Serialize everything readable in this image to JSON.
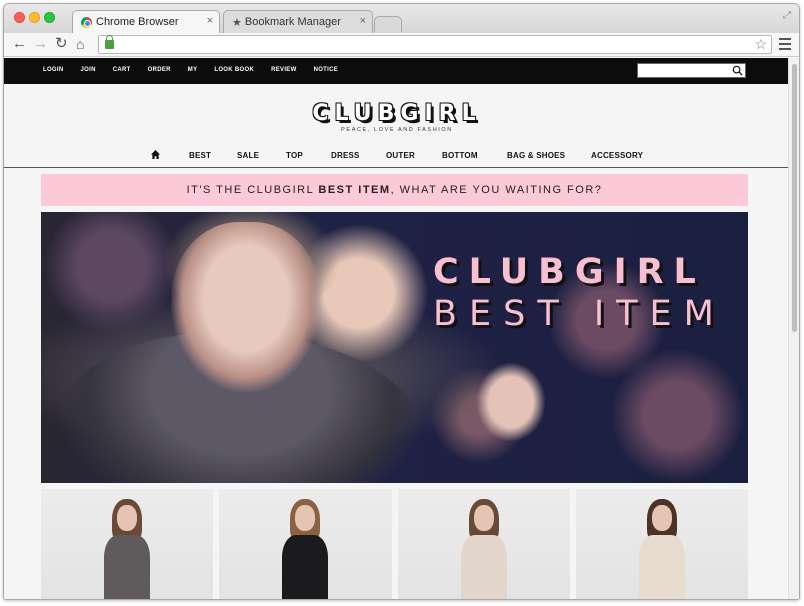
{
  "browser": {
    "tabs": [
      {
        "label": "Chrome Browser",
        "active": true
      },
      {
        "label": "Bookmark Manager",
        "active": false
      }
    ],
    "url": ""
  },
  "site": {
    "top_links": [
      "LOGIN",
      "JOIN",
      "CART",
      "ORDER",
      "MY",
      "LOOK BOOK",
      "REVIEW",
      "NOTICE"
    ],
    "search_placeholder": "",
    "logo": "CLUBGIRL",
    "tagline": "PEACE, LOVE AND FASHION",
    "nav": [
      "BEST",
      "SALE",
      "TOP",
      "DRESS",
      "OUTER",
      "BOTTOM",
      "BAG & SHOES",
      "ACCESSORY"
    ],
    "promo": {
      "prefix": "IT'S THE CLUBGIRL ",
      "highlight": "BEST ITEM",
      "suffix": ", WHAT ARE YOU WAITING FOR?"
    },
    "hero": {
      "title": "CLUBGIRL",
      "subtitle": "BEST ITEM"
    },
    "products": [
      {
        "outfit_color": "#5f5b5c",
        "hair_color": "#6b4a35"
      },
      {
        "outfit_color": "#1b1b1e",
        "hair_color": "#8a6240"
      },
      {
        "outfit_color": "#e2d6cc",
        "hair_color": "#6b4a35"
      },
      {
        "outfit_color": "#e8dbd0",
        "hair_color": "#4c3326"
      }
    ]
  },
  "colors": {
    "promo_bg": "#fcc9d8",
    "hero_text": "#f8bfd0",
    "topbar_bg": "#0c0c0c"
  }
}
